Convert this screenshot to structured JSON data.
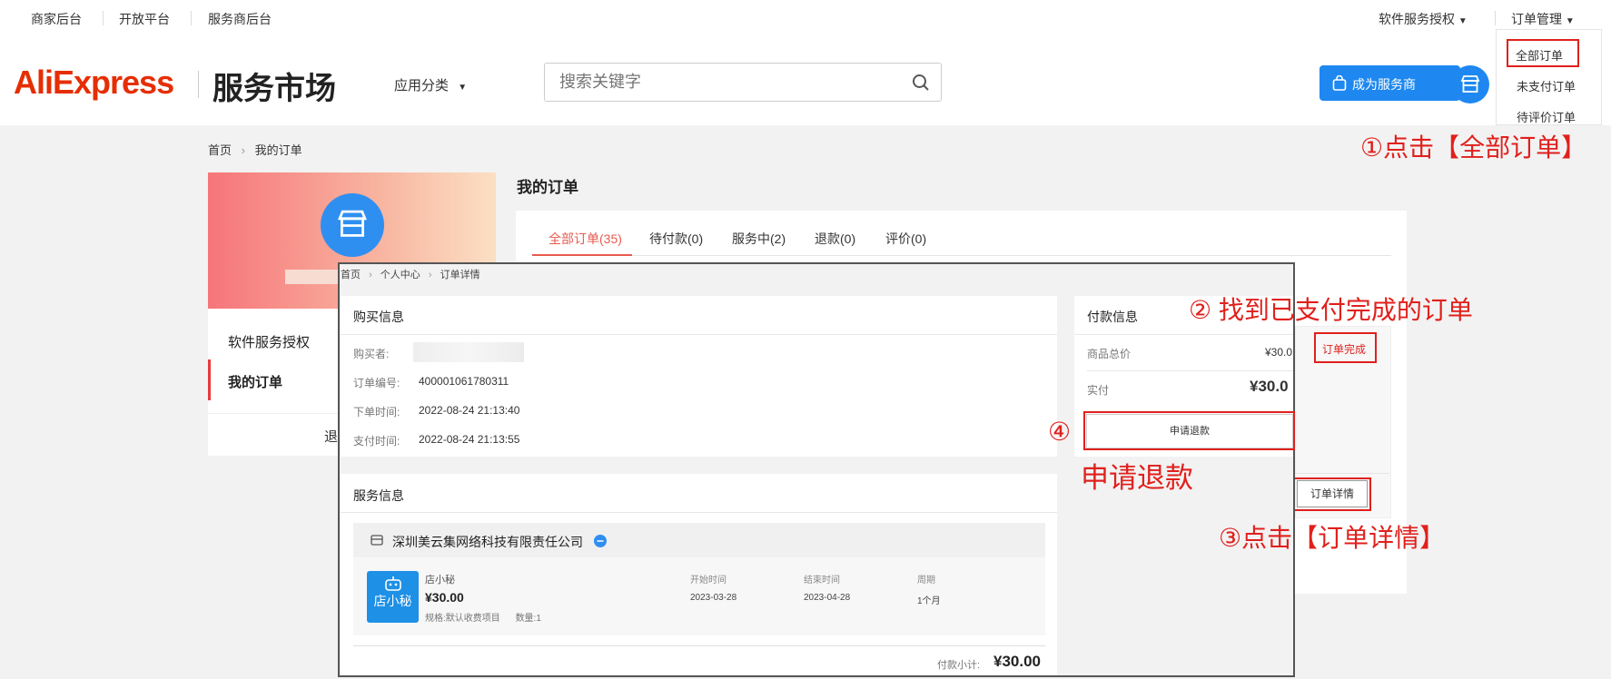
{
  "top_nav": {
    "left_links": [
      "商家后台",
      "开放平台",
      "服务商后台"
    ],
    "software_auth": "软件服务授权",
    "order_mgmt": "订单管理"
  },
  "dropdown": {
    "items": [
      "全部订单",
      "未支付订单",
      "待评价订单"
    ]
  },
  "header": {
    "logo_brand": "AliExpress",
    "logo_market": "服务市场",
    "category_menu": "应用分类",
    "search_placeholder": "搜索关键字",
    "become_provider": "成为服务商"
  },
  "breadcrumb": {
    "home": "首页",
    "current": "我的订单"
  },
  "sidebar": {
    "items": [
      "软件服务授权",
      "我的订单"
    ],
    "logout_partial": "退"
  },
  "main": {
    "title": "我的订单",
    "tabs": [
      "全部订单(35)",
      "待付款(0)",
      "服务中(2)",
      "退款(0)",
      "评价(0)"
    ]
  },
  "order_side": {
    "status": "订单完成",
    "detail_button": "订单详情"
  },
  "overlay": {
    "breadcrumb": [
      "首页",
      "个人中心",
      "订单详情"
    ],
    "purchase": {
      "title": "购买信息",
      "rows": [
        {
          "label": "购买者:",
          "value": ""
        },
        {
          "label": "订单编号:",
          "value": "400001061780311"
        },
        {
          "label": "下单时间:",
          "value": "2022-08-24 21:13:40"
        },
        {
          "label": "支付时间:",
          "value": "2022-08-24 21:13:55"
        }
      ]
    },
    "payment": {
      "title": "付款信息",
      "total_label": "商品总价",
      "total_value": "¥30.0",
      "paid_label": "实付",
      "paid_value": "¥30.0",
      "refund_button": "申请退款"
    },
    "service": {
      "title": "服务信息",
      "company": "深圳美云集网络科技有限责任公司",
      "product_name": "店小秘",
      "product_icon_text": "店小秘",
      "price": "¥30.00",
      "spec_label": "规格:",
      "spec_value": "默认收费项目",
      "qty_label": "数量:",
      "qty_value": "1",
      "cols": [
        "开始时间",
        "结束时间",
        "周期"
      ],
      "col_values": [
        "2023-03-28",
        "2023-04-28",
        "1个月"
      ],
      "subtotal_label": "付款小计:",
      "subtotal_value": "¥30.00"
    }
  },
  "annotations": {
    "step1": "①点击【全部订单】",
    "step2": "② 找到已支付完成的订单",
    "step3": "③点击【订单详情】",
    "step4_num": "④",
    "step4_text": "申请退款"
  },
  "colors": {
    "accent_blue": "#1e88f0",
    "annotation_red": "#e0201c",
    "brand_red": "#e62e04"
  }
}
